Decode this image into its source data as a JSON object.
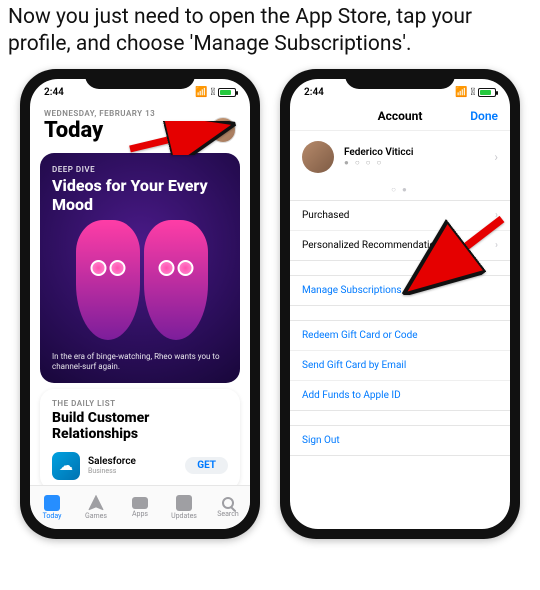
{
  "caption": "Now you just need to open the App Store, tap your profile, and choose 'Manage Subscriptions'.",
  "statusbar": {
    "time": "2:44"
  },
  "left": {
    "date": "WEDNESDAY, FEBRUARY 13",
    "title": "Today",
    "card": {
      "tag": "DEEP DIVE",
      "title": "Videos for Your Every Mood",
      "sub": "In the era of binge-watching, Rheo wants you to channel-surf again."
    },
    "listcard": {
      "tag": "THE DAILY LIST",
      "title": "Build Customer Relationships",
      "app": {
        "name": "Salesforce",
        "sub": "Business"
      },
      "get": "GET"
    },
    "tabs": [
      "Today",
      "Games",
      "Apps",
      "Updates",
      "Search"
    ]
  },
  "right": {
    "nav": {
      "title": "Account",
      "done": "Done"
    },
    "user": {
      "name": "Federico Viticci"
    },
    "rows1": [
      "Purchased",
      "Personalized Recommendations"
    ],
    "rows2": [
      "Manage Subscriptions"
    ],
    "rows3": [
      "Redeem Gift Card or Code",
      "Send Gift Card by Email",
      "Add Funds to Apple ID"
    ],
    "rows4": [
      "Sign Out"
    ]
  }
}
